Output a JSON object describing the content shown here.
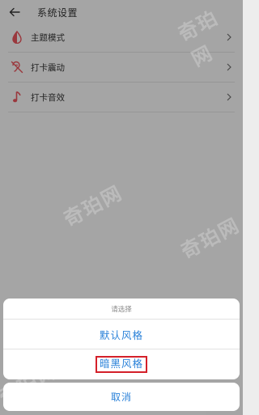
{
  "header": {
    "title": "系统设置",
    "back_icon": "back-arrow-icon"
  },
  "settings": [
    {
      "label": "主题模式",
      "icon": "theme-drop-icon",
      "color": "#e4535b"
    },
    {
      "label": "打卡震动",
      "icon": "vibration-ear-icon",
      "color": "#e4535b"
    },
    {
      "label": "打卡音效",
      "icon": "music-note-icon",
      "color": "#e4535b"
    }
  ],
  "sheet": {
    "header": "请选择",
    "options": [
      "默认风格",
      "暗黑风格"
    ],
    "cancel": "取消",
    "accent_color": "#2b82d9",
    "highlight_color": "#d4202a"
  },
  "watermark": "奇珀网"
}
